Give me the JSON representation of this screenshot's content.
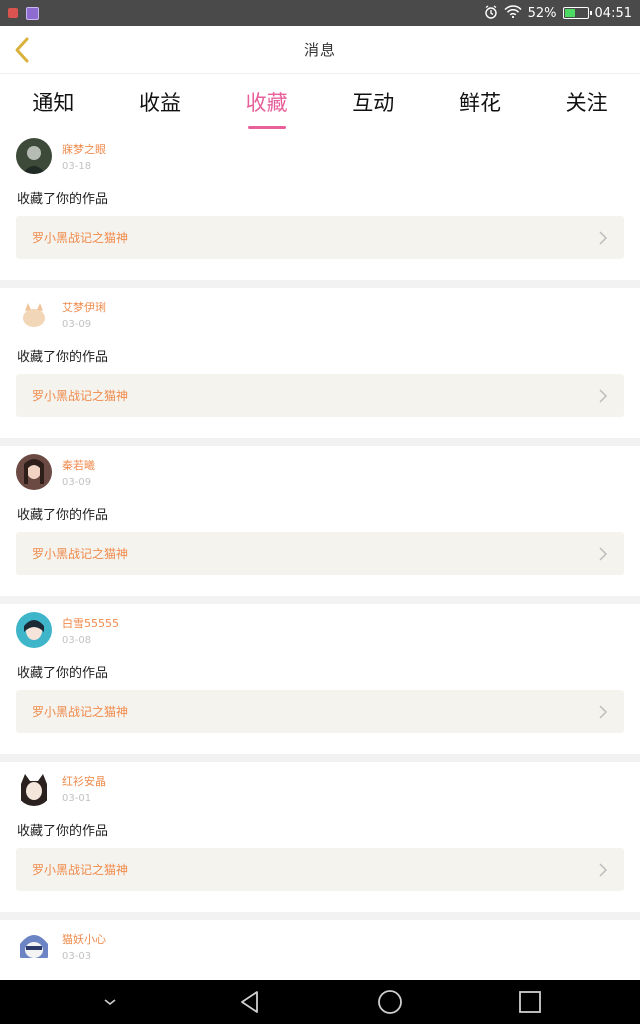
{
  "status_bar": {
    "battery_level": 52,
    "battery_text": "52%",
    "time": "04:51",
    "icons": [
      "alarm-icon",
      "wifi-icon",
      "battery-icon"
    ]
  },
  "header": {
    "title": "消息",
    "back_icon": "chevron-left-icon"
  },
  "tabs": [
    {
      "label": "通知"
    },
    {
      "label": "收益"
    },
    {
      "label": "收藏"
    },
    {
      "label": "互动"
    },
    {
      "label": "鲜花"
    },
    {
      "label": "关注"
    }
  ],
  "active_tab": "收藏",
  "items": [
    {
      "username": "寐梦之眼",
      "date": "03-18",
      "action": "收藏了你的作品",
      "work_title": "罗小黑战记之猫神",
      "avatar_color": "#3d4a3a"
    },
    {
      "username": "艾梦伊琍",
      "date": "03-09",
      "action": "收藏了你的作品",
      "work_title": "罗小黑战记之猫神",
      "avatar_color": "#f2d6b8"
    },
    {
      "username": "秦若曦",
      "date": "03-09",
      "action": "收藏了你的作品",
      "work_title": "罗小黑战记之猫神",
      "avatar_color": "#6b4a43"
    },
    {
      "username": "白雪55555",
      "date": "03-08",
      "action": "收藏了你的作品",
      "work_title": "罗小黑战记之猫神",
      "avatar_color": "#3fb5c9"
    },
    {
      "username": "红衫安晶",
      "date": "03-01",
      "action": "收藏了你的作品",
      "work_title": "罗小黑战记之猫神",
      "avatar_color": "#2b2220"
    },
    {
      "username": "猫妖小心",
      "date": "03-03",
      "action": "",
      "work_title": "",
      "avatar_color": "#6d84c4"
    }
  ],
  "colors": {
    "accent": "#e8609a",
    "username": "#f08a4b",
    "card_bg": "#f4f3ee"
  },
  "nav": [
    "collapse-icon",
    "back-triangle-icon",
    "home-circle-icon",
    "recents-square-icon"
  ]
}
